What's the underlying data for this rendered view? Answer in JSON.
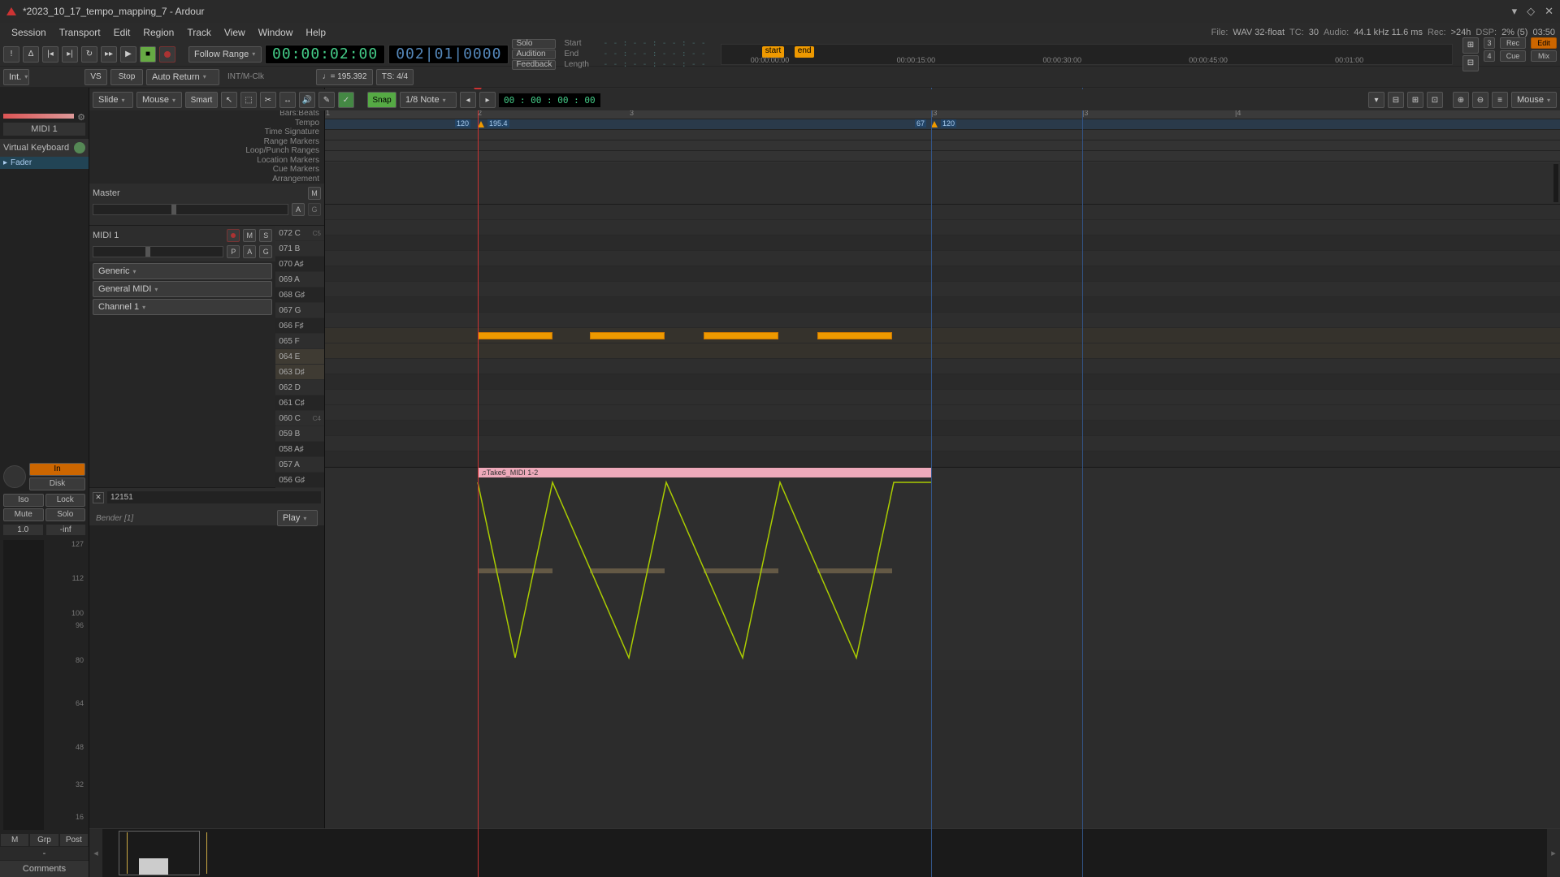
{
  "window": {
    "title": "*2023_10_17_tempo_mapping_7 - Ardour"
  },
  "menu": {
    "items": [
      "Session",
      "Transport",
      "Edit",
      "Region",
      "Track",
      "View",
      "Window",
      "Help"
    ]
  },
  "statusbar": {
    "file_l": "File:",
    "file": "WAV 32-float",
    "tc_l": "TC:",
    "tc": "30",
    "audio_l": "Audio:",
    "audio": "44.1 kHz 11.6 ms",
    "rec_l": "Rec:",
    "rec": ">24h",
    "dsp_l": "DSP:",
    "dsp": "2% (5)",
    "time": "03:50"
  },
  "transport": {
    "follow": "Follow Range",
    "clock1": "00:00:02:00",
    "clock2": "002|01|0000",
    "solo": "Solo",
    "audition": "Audition",
    "feedback": "Feedback",
    "start_l": "Start",
    "end_l": "End",
    "len_l": "Length",
    "dashes": "- - : - - : - - : - -",
    "int": "Int.",
    "vs": "VS",
    "stop": "Stop",
    "autoret": "Auto Return",
    "sync": "INT/M-Clk",
    "tempo": "♩= 195.392",
    "ts": "TS: 4/4"
  },
  "markers": {
    "start": "start",
    "end": "end",
    "t1": "00:00:00:00",
    "t2": "00:00:15:00",
    "t3": "00:00:30:00",
    "t4": "00:00:45:00",
    "t5": "00:01:00"
  },
  "modebtns": {
    "rec": "Rec",
    "edit": "Edit",
    "cue": "Cue",
    "mix": "Mix",
    "n3": "3",
    "n4": "4"
  },
  "editbar": {
    "slide": "Slide",
    "mouse": "Mouse",
    "smart": "Smart",
    "snap": "Snap",
    "grid": "1/8 Note",
    "time": "00 : 00 : 00 : 00",
    "mouse2": "Mouse"
  },
  "rulers": {
    "labels": [
      "Bars:Beats",
      "Tempo",
      "Time Signature",
      "Range Markers",
      "Loop/Punch Ranges",
      "Location Markers",
      "Cue Markers",
      "Arrangement"
    ],
    "bars": [
      "1",
      "2",
      "3",
      "|3",
      "|4"
    ],
    "tempo1": "120",
    "tempo2": "195.4",
    "tempo3": "67",
    "tempo4": "120"
  },
  "left": {
    "midi": "MIDI 1",
    "vk": "Virtual Keyboard",
    "fader": "Fader",
    "in": "In",
    "disk": "Disk",
    "iso": "Iso",
    "lock": "Lock",
    "mute": "Mute",
    "solo": "Solo",
    "v1": "1.0",
    "v2": "-inf",
    "m": "M",
    "grp": "Grp",
    "post": "Post",
    "dash": "-",
    "comments": "Comments",
    "scale": [
      "127",
      "112",
      "100",
      "96",
      "80",
      "64",
      "48",
      "32",
      "16"
    ]
  },
  "mid": {
    "master": "Master",
    "m": "M",
    "a": "A",
    "g": "G",
    "s": "S",
    "p": "P",
    "midi": "MIDI 1",
    "generic": "Generic",
    "gm": "General MIDI",
    "chan": "Channel  1",
    "ctrlval": "12151",
    "bender": "Bender [1]",
    "play": "Play",
    "keys": [
      {
        "n": "072 C",
        "b": false,
        "o": "C5"
      },
      {
        "n": "071 B",
        "b": false
      },
      {
        "n": "070 A♯",
        "b": true
      },
      {
        "n": "069 A",
        "b": false
      },
      {
        "n": "068 G♯",
        "b": true
      },
      {
        "n": "067 G",
        "b": false
      },
      {
        "n": "066 F♯",
        "b": true
      },
      {
        "n": "065 F",
        "b": false
      },
      {
        "n": "064 E",
        "b": false,
        "sel": true
      },
      {
        "n": "063 D♯",
        "b": true,
        "sel": true
      },
      {
        "n": "062 D",
        "b": false
      },
      {
        "n": "061 C♯",
        "b": true
      },
      {
        "n": "060 C",
        "b": false,
        "o": "C4"
      },
      {
        "n": "059 B",
        "b": false
      },
      {
        "n": "058 A♯",
        "b": true
      },
      {
        "n": "057 A",
        "b": false
      },
      {
        "n": "056 G♯",
        "b": true
      }
    ]
  },
  "region": {
    "name": "♫Take6_MIDI 1-2"
  }
}
